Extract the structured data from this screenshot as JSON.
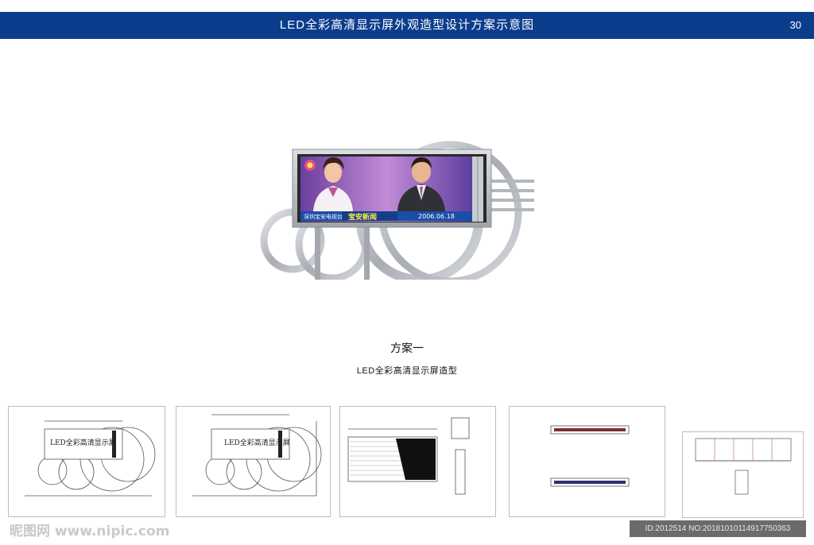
{
  "header": {
    "title": "LED全彩高清显示屏外观造型设计方案示意图",
    "page_number": "30",
    "bar_color": "#0b3d8c"
  },
  "screen": {
    "station": "深圳宝安电视台",
    "program": "宝安新闻",
    "date": "2006.06.18"
  },
  "captions": {
    "scheme": "方案一",
    "subtitle": "LED全彩高清显示屏造型"
  },
  "thumbnails": {
    "drawing_label": "LED全彩高清显示屏"
  },
  "footer": {
    "watermark": "昵图网 www.nipic.com",
    "id_text": "ID:2012514 NO:20181010114917750363"
  }
}
